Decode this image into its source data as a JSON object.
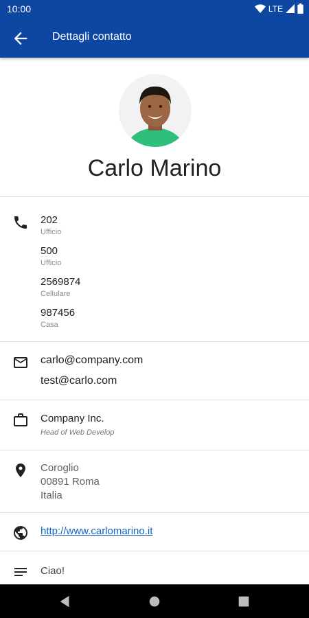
{
  "status": {
    "time": "10:00",
    "network": "LTE"
  },
  "appbar": {
    "title": "Dettagli contatto"
  },
  "contact": {
    "name": "Carlo Marino"
  },
  "phones": [
    {
      "number": "202",
      "type": "Ufficio"
    },
    {
      "number": "500",
      "type": "Ufficio"
    },
    {
      "number": "2569874",
      "type": "Cellulare"
    },
    {
      "number": "987456",
      "type": "Casa"
    }
  ],
  "emails": [
    "carlo@company.com",
    "test@carlo.com"
  ],
  "company": {
    "name": "Company Inc.",
    "title": "Head of Web Develop"
  },
  "address": {
    "line1": "Coroglio",
    "line2": "00891 Roma",
    "line3": "Italia"
  },
  "website": "http://www.carlomarino.it",
  "note": "Ciao!",
  "colors": {
    "primary": "#0d47a1",
    "link": "#1565c0"
  }
}
